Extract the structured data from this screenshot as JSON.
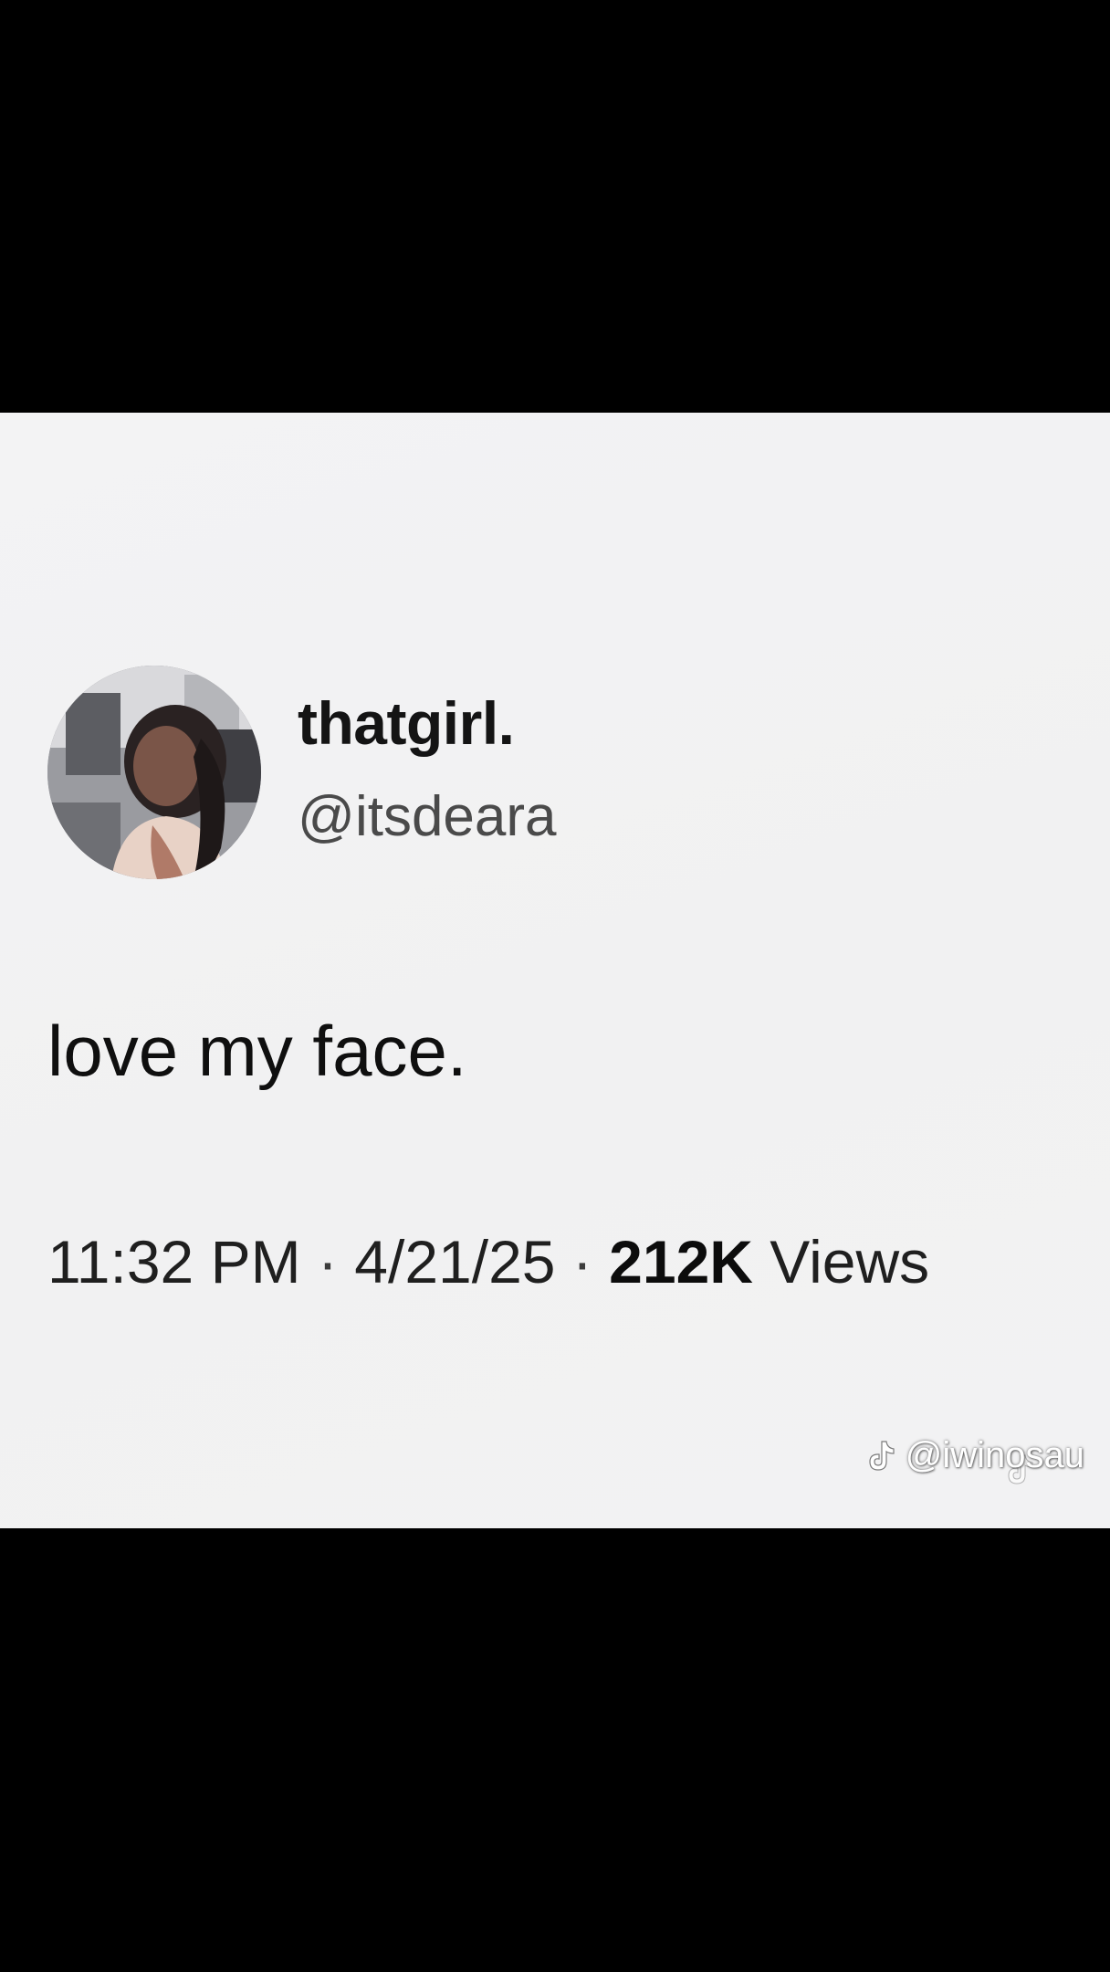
{
  "tweet": {
    "display_name": "thatgirl.",
    "handle": "@itsdeara",
    "text": "love my face.",
    "time": "11:32 PM",
    "separator": "·",
    "date": "4/21/25",
    "views_count": "212K",
    "views_label": "Views"
  },
  "watermark": {
    "icon": "tiktok-icon",
    "handle": "@iwinosau"
  },
  "colors": {
    "card_background": "#f2f2f3",
    "letterbox": "#000000",
    "text_primary": "#141414",
    "text_secondary": "#4a4a4a"
  }
}
